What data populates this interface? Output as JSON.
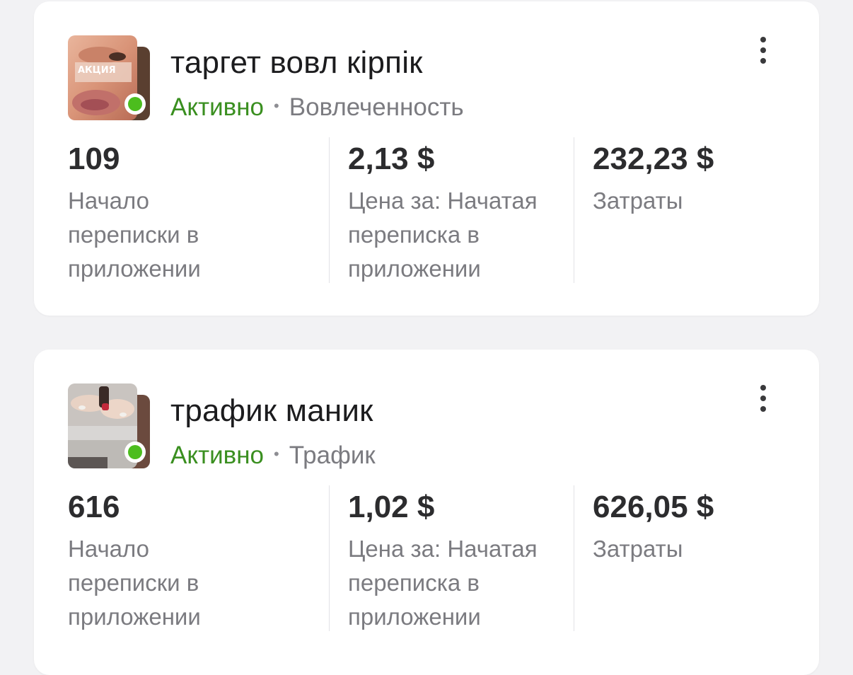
{
  "campaigns": [
    {
      "name": "таргет вовл кірпік",
      "status": "Активно",
      "separator": "•",
      "objective": "Вовлеченность",
      "thumbnail_caption": "АКЦИЯ",
      "metrics": [
        {
          "value": "109",
          "label": "Начало переписки в приложении"
        },
        {
          "value": "2,13 $",
          "label": "Цена за: Начатая переписка в приложении"
        },
        {
          "value": "232,23 $",
          "label": "Затраты"
        }
      ]
    },
    {
      "name": "трафик маник",
      "status": "Активно",
      "separator": "•",
      "objective": "Трафик",
      "metrics": [
        {
          "value": "616",
          "label": "Начало переписки в приложении"
        },
        {
          "value": "1,02 $",
          "label": "Цена за: Начатая переписка в приложении"
        },
        {
          "value": "626,05 $",
          "label": "Затраты"
        }
      ]
    }
  ],
  "colors": {
    "active_text": "#3a8f20",
    "active_dot": "#4cbd1e",
    "card_bg": "#ffffff",
    "page_bg": "#f2f2f4"
  },
  "icons": {
    "menu": "more-vertical-icon",
    "status": "status-active-dot"
  }
}
